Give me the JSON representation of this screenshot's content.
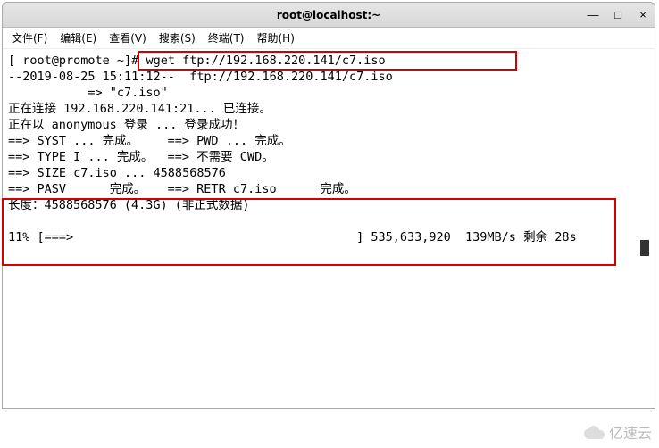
{
  "window": {
    "title": "root@localhost:~",
    "controls": {
      "min": "—",
      "max": "□",
      "close": "×"
    }
  },
  "menu": {
    "file": "文件(F)",
    "edit": "编辑(E)",
    "view": "查看(V)",
    "search": "搜索(S)",
    "terminal": "终端(T)",
    "help": "帮助(H)"
  },
  "terminal": {
    "prompt": "[ root@promote ~]#",
    "command": "wget ftp://192.168.220.141/c7.iso",
    "line_ts": "--2019-08-25 15:11:12--  ftp://192.168.220.141/c7.iso",
    "line_arrow_file": "           => \"c7.iso\"",
    "line_connect": "正在连接 192.168.220.141:21... 已连接。",
    "line_login": "正在以 anonymous 登录 ... 登录成功！",
    "line_syst": "==> SYST ... 完成。    ==> PWD ... 完成。",
    "line_type": "==> TYPE I ... 完成。  ==> 不需要 CWD。",
    "line_size": "==> SIZE c7.iso ... 4588568576",
    "line_pasv": "==> PASV      完成。   ==> RETR c7.iso      完成。",
    "line_len": "长度：4588568576 (4.3G) (非正式数据)",
    "progress_line": "11% [===>                                       ] 535,633,920  139MB/s 剩余 28s"
  },
  "watermark": {
    "text": "亿速云"
  }
}
